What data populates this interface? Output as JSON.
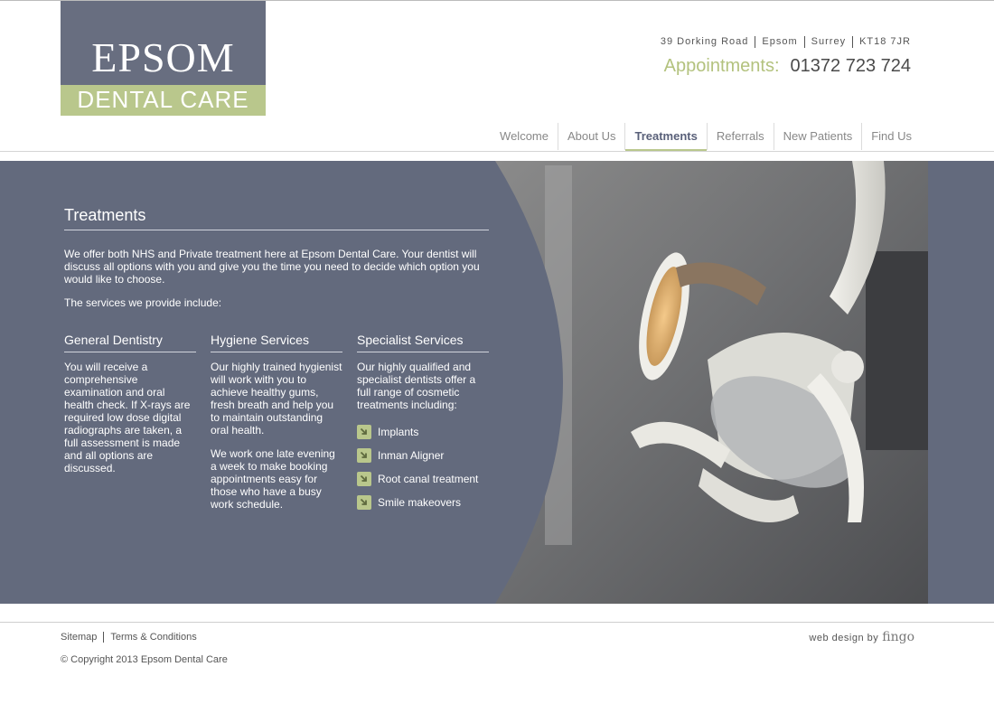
{
  "logo": {
    "name": "EPSOM",
    "subtitle": "DENTAL CARE"
  },
  "contact": {
    "address": [
      "39 Dorking Road",
      "Epsom",
      "Surrey",
      "KT18 7JR"
    ],
    "appointments_label": "Appointments:",
    "phone": "01372 723 724"
  },
  "nav": {
    "items": [
      {
        "label": "Welcome"
      },
      {
        "label": "About Us"
      },
      {
        "label": "Treatments",
        "active": true
      },
      {
        "label": "Referrals"
      },
      {
        "label": "New Patients"
      },
      {
        "label": "Find Us"
      }
    ]
  },
  "main": {
    "title": "Treatments",
    "intro": "We offer both NHS and Private treatment here at Epsom Dental Care. Your dentist will discuss all options with you and give you the time you need to decide which option you would like to choose.",
    "services_intro": "The services we provide include:",
    "columns": [
      {
        "heading": "General Dentistry",
        "paragraphs": [
          "You will receive a comprehensive examination and oral health check. If X-rays are required low dose digital radiographs are taken, a full assessment is made and all options are discussed."
        ]
      },
      {
        "heading": "Hygiene Services",
        "paragraphs": [
          "Our highly trained hygienist will work with you to achieve healthy gums, fresh breath and help you to maintain outstanding oral health.",
          "We work one late evening a week to make booking appointments easy for those who have a busy work schedule."
        ]
      },
      {
        "heading": "Specialist Services",
        "paragraphs": [
          "Our highly qualified and specialist dentists offer a full range of cosmetic treatments including:"
        ],
        "list": [
          "Implants",
          "Inman Aligner",
          "Root canal treatment",
          "Smile makeovers"
        ]
      }
    ]
  },
  "footer": {
    "links": [
      "Sitemap",
      "Terms & Conditions"
    ],
    "copyright": "© Copyright 2013 Epsom Dental Care",
    "credit_label": "web design by",
    "credit_brand": "fingo"
  },
  "colors": {
    "slate": "#636a7d",
    "accent_green": "#b9c78c",
    "appointments_green": "#b3c27e"
  },
  "icons": {
    "list_bullet": "arrow-down-right-icon"
  }
}
